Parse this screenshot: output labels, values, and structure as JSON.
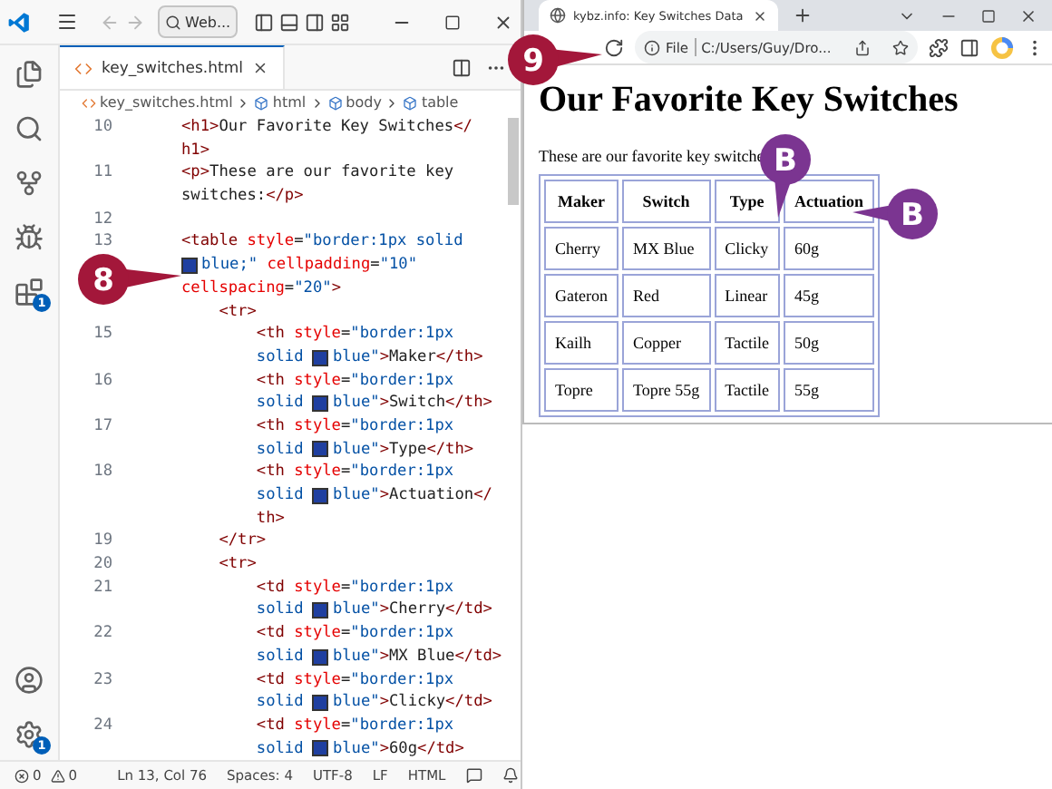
{
  "vscode": {
    "search": "Web...",
    "tab": {
      "label": "key_switches.html",
      "selected": true
    },
    "breadcrumbs": [
      "key_switches.html",
      "html",
      "body",
      "table"
    ],
    "badges": {
      "extensions": "1",
      "settings": "1"
    },
    "code_rows": [
      {
        "number": "10",
        "segments": [
          {
            "kind": "tag",
            "text": "<h1>"
          },
          {
            "kind": "text",
            "text": "Our Favorite Key Switches"
          },
          {
            "kind": "tag",
            "text": "</"
          }
        ]
      },
      {
        "segments": [
          {
            "kind": "tag",
            "text": "h1>"
          }
        ]
      },
      {
        "number": "11",
        "segments": [
          {
            "kind": "tag",
            "text": "<p>"
          },
          {
            "kind": "text",
            "text": "These are our favorite key"
          }
        ]
      },
      {
        "segments": [
          {
            "kind": "text",
            "text": "switches:"
          },
          {
            "kind": "tag",
            "text": "</p>"
          }
        ]
      },
      {
        "number": "12"
      },
      {
        "number": "13",
        "segments": [
          {
            "kind": "tag",
            "text": "<table"
          },
          {
            "kind": "attr",
            "text": " style"
          },
          {
            "kind": "text",
            "text": "="
          },
          {
            "kind": "value",
            "text": "\"border:1px solid"
          }
        ]
      },
      {
        "segments": [
          {
            "kind": "swatch"
          },
          {
            "kind": "value",
            "text": "blue;\""
          },
          {
            "kind": "attr",
            "text": " cellpadding"
          },
          {
            "kind": "text",
            "text": "="
          },
          {
            "kind": "value",
            "text": "\"10\""
          }
        ]
      },
      {
        "segments": [
          {
            "kind": "attr",
            "text": "cellspacing"
          },
          {
            "kind": "text",
            "text": "="
          },
          {
            "kind": "value",
            "text": "\"20\""
          },
          {
            "kind": "tag",
            "text": ">"
          }
        ]
      },
      {
        "segments": [
          {
            "kind": "tag",
            "text": "    <tr>"
          }
        ]
      },
      {
        "number": "15",
        "segments": [
          {
            "kind": "tag",
            "text": "        <th"
          },
          {
            "kind": "attr",
            "text": " style"
          },
          {
            "kind": "text",
            "text": "="
          },
          {
            "kind": "value",
            "text": "\"border:1px"
          }
        ]
      },
      {
        "segments": [
          {
            "kind": "value",
            "text": "        solid "
          },
          {
            "kind": "swatch"
          },
          {
            "kind": "value",
            "text": "blue\""
          },
          {
            "kind": "tag",
            "text": ">"
          },
          {
            "kind": "text",
            "text": "Maker"
          },
          {
            "kind": "tag",
            "text": "</th>"
          }
        ]
      },
      {
        "number": "16",
        "segments": [
          {
            "kind": "tag",
            "text": "        <th"
          },
          {
            "kind": "attr",
            "text": " style"
          },
          {
            "kind": "text",
            "text": "="
          },
          {
            "kind": "value",
            "text": "\"border:1px"
          }
        ]
      },
      {
        "segments": [
          {
            "kind": "value",
            "text": "        solid "
          },
          {
            "kind": "swatch"
          },
          {
            "kind": "value",
            "text": "blue\""
          },
          {
            "kind": "tag",
            "text": ">"
          },
          {
            "kind": "text",
            "text": "Switch"
          },
          {
            "kind": "tag",
            "text": "</th>"
          }
        ]
      },
      {
        "number": "17",
        "segments": [
          {
            "kind": "tag",
            "text": "        <th"
          },
          {
            "kind": "attr",
            "text": " style"
          },
          {
            "kind": "text",
            "text": "="
          },
          {
            "kind": "value",
            "text": "\"border:1px"
          }
        ]
      },
      {
        "segments": [
          {
            "kind": "value",
            "text": "        solid "
          },
          {
            "kind": "swatch"
          },
          {
            "kind": "value",
            "text": "blue\""
          },
          {
            "kind": "tag",
            "text": ">"
          },
          {
            "kind": "text",
            "text": "Type"
          },
          {
            "kind": "tag",
            "text": "</th>"
          }
        ]
      },
      {
        "number": "18",
        "segments": [
          {
            "kind": "tag",
            "text": "        <th"
          },
          {
            "kind": "attr",
            "text": " style"
          },
          {
            "kind": "text",
            "text": "="
          },
          {
            "kind": "value",
            "text": "\"border:1px"
          }
        ]
      },
      {
        "segments": [
          {
            "kind": "value",
            "text": "        solid "
          },
          {
            "kind": "swatch"
          },
          {
            "kind": "value",
            "text": "blue\""
          },
          {
            "kind": "tag",
            "text": ">"
          },
          {
            "kind": "text",
            "text": "Actuation"
          },
          {
            "kind": "tag",
            "text": "</"
          }
        ]
      },
      {
        "segments": [
          {
            "kind": "tag",
            "text": "        th>"
          }
        ]
      },
      {
        "number": "19",
        "segments": [
          {
            "kind": "tag",
            "text": "    </tr>"
          }
        ]
      },
      {
        "number": "20",
        "segments": [
          {
            "kind": "tag",
            "text": "    <tr>"
          }
        ]
      },
      {
        "number": "21",
        "segments": [
          {
            "kind": "tag",
            "text": "        <td"
          },
          {
            "kind": "attr",
            "text": " style"
          },
          {
            "kind": "text",
            "text": "="
          },
          {
            "kind": "value",
            "text": "\"border:1px"
          }
        ]
      },
      {
        "segments": [
          {
            "kind": "value",
            "text": "        solid "
          },
          {
            "kind": "swatch"
          },
          {
            "kind": "value",
            "text": "blue\""
          },
          {
            "kind": "tag",
            "text": ">"
          },
          {
            "kind": "text",
            "text": "Cherry"
          },
          {
            "kind": "tag",
            "text": "</td>"
          }
        ]
      },
      {
        "number": "22",
        "segments": [
          {
            "kind": "tag",
            "text": "        <td"
          },
          {
            "kind": "attr",
            "text": " style"
          },
          {
            "kind": "text",
            "text": "="
          },
          {
            "kind": "value",
            "text": "\"border:1px"
          }
        ]
      },
      {
        "segments": [
          {
            "kind": "value",
            "text": "        solid "
          },
          {
            "kind": "swatch"
          },
          {
            "kind": "value",
            "text": "blue\""
          },
          {
            "kind": "tag",
            "text": ">"
          },
          {
            "kind": "text",
            "text": "MX Blue"
          },
          {
            "kind": "tag",
            "text": "</td>"
          }
        ]
      },
      {
        "number": "23",
        "segments": [
          {
            "kind": "tag",
            "text": "        <td"
          },
          {
            "kind": "attr",
            "text": " style"
          },
          {
            "kind": "text",
            "text": "="
          },
          {
            "kind": "value",
            "text": "\"border:1px"
          }
        ]
      },
      {
        "segments": [
          {
            "kind": "value",
            "text": "        solid "
          },
          {
            "kind": "swatch"
          },
          {
            "kind": "value",
            "text": "blue\""
          },
          {
            "kind": "tag",
            "text": ">"
          },
          {
            "kind": "text",
            "text": "Clicky"
          },
          {
            "kind": "tag",
            "text": "</td>"
          }
        ]
      },
      {
        "number": "24",
        "segments": [
          {
            "kind": "tag",
            "text": "        <td"
          },
          {
            "kind": "attr",
            "text": " style"
          },
          {
            "kind": "text",
            "text": "="
          },
          {
            "kind": "value",
            "text": "\"border:1px"
          }
        ]
      },
      {
        "segments": [
          {
            "kind": "value",
            "text": "        solid "
          },
          {
            "kind": "swatch"
          },
          {
            "kind": "value",
            "text": "blue\""
          },
          {
            "kind": "tag",
            "text": ">"
          },
          {
            "kind": "text",
            "text": "60g"
          },
          {
            "kind": "tag",
            "text": "</td>"
          }
        ]
      }
    ],
    "status_bar": {
      "errors": "0",
      "warnings": "0",
      "items": [
        "Ln 13, Col 76",
        "Spaces: 4",
        "UTF-8",
        "LF",
        "HTML"
      ]
    }
  },
  "browser": {
    "tab_title": "kybz.info: Key Switches Data",
    "address_scheme": "File",
    "address": "C:/Users/Guy/Dro...",
    "page": {
      "heading": "Our Favorite Key Switches",
      "paragraph": "These are our favorite key switche",
      "table": {
        "columns": [
          "Maker",
          "Switch",
          "Type",
          "Actuation"
        ],
        "rows": [
          [
            "Cherry",
            "MX Blue",
            "Clicky",
            "60g"
          ],
          [
            "Gateron",
            "Red",
            "Linear",
            "45g"
          ],
          [
            "Kailh",
            "Copper",
            "Tactile",
            "50g"
          ],
          [
            "Topre",
            "Topre 55g",
            "Tactile",
            "55g"
          ]
        ]
      }
    }
  },
  "callouts": [
    {
      "label": "8",
      "color": "#a3173a"
    },
    {
      "label": "9",
      "color": "#a3173a"
    },
    {
      "label": "B",
      "color": "#7b3591"
    },
    {
      "label": "B",
      "color": "#7b3591"
    }
  ]
}
